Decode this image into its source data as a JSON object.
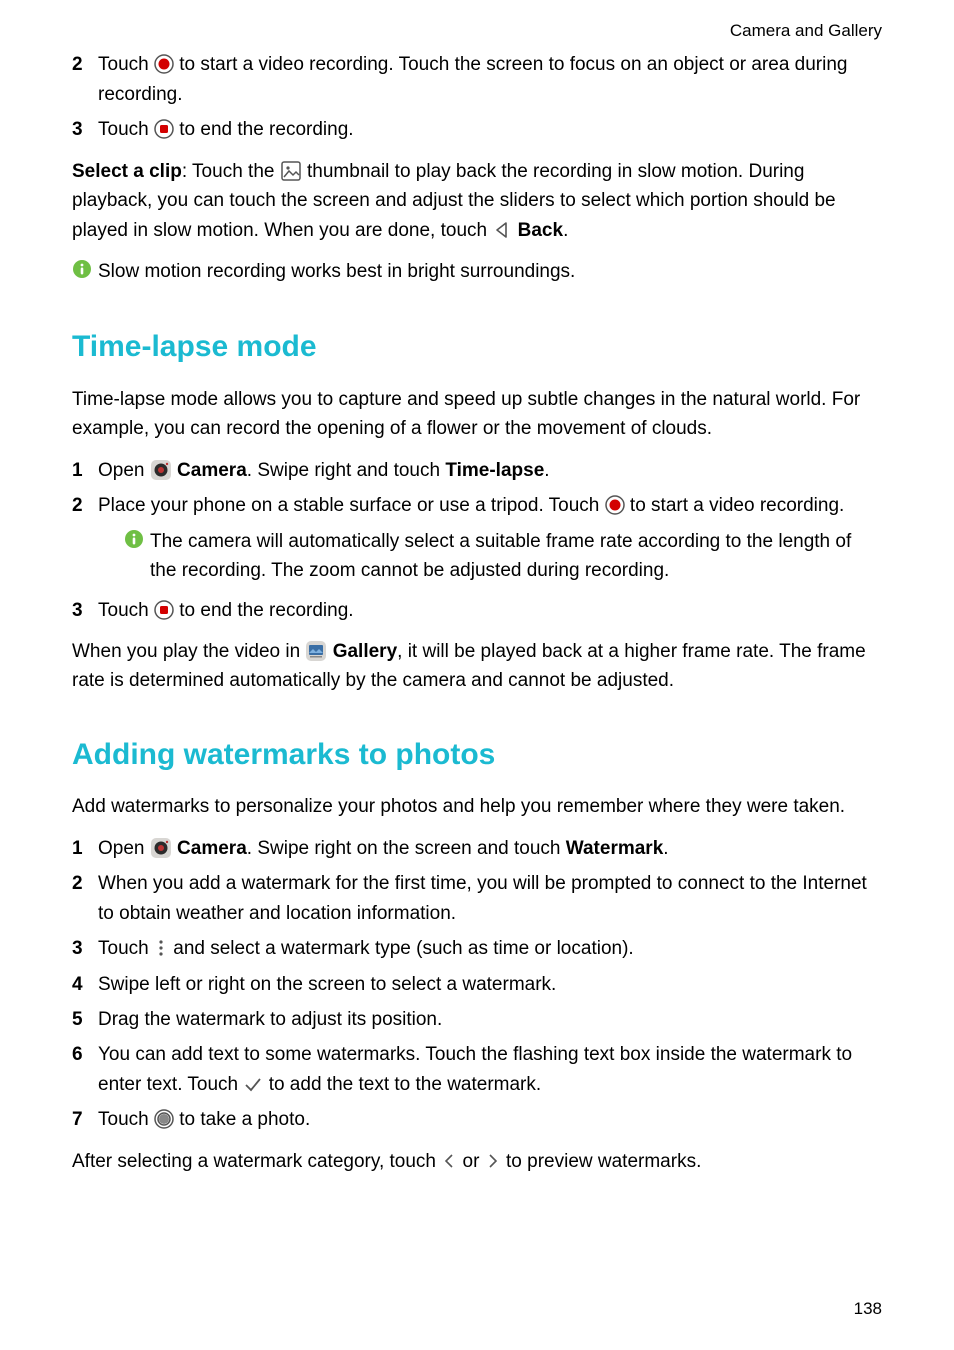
{
  "header": {
    "breadcrumb": "Camera and Gallery"
  },
  "page_number": "138",
  "slowmo": {
    "step2_a": "Touch ",
    "step2_b": " to start a video recording. Touch the screen to focus on an object or area during recording.",
    "step3_a": "Touch ",
    "step3_b": " to end the recording.",
    "select_label": "Select a clip",
    "select_a": ": Touch the ",
    "select_b": " thumbnail to play back the recording in slow motion. During playback, you can touch the screen and adjust the sliders to select which portion should be played in slow motion. When you are done, touch ",
    "back_label": "Back",
    "select_c": ".",
    "note": "Slow motion recording works best in bright surroundings."
  },
  "timelapse": {
    "heading": "Time-lapse mode",
    "intro": "Time-lapse mode allows you to capture and speed up subtle changes in the natural world. For example, you can record the opening of a flower or the movement of clouds.",
    "step1_a": "Open ",
    "camera_label": "Camera",
    "step1_b": ". Swipe right and touch ",
    "timelapse_label": "Time-lapse",
    "step1_c": ".",
    "step2_a": "Place your phone on a stable surface or use a tripod. Touch ",
    "step2_b": " to start a video recording.",
    "step2_note": "The camera will automatically select a suitable frame rate according to the length of the recording. The zoom cannot be adjusted during recording.",
    "step3_a": "Touch ",
    "step3_b": " to end the recording.",
    "outro_a": "When you play the video in ",
    "gallery_label": "Gallery",
    "outro_b": ", it will be played back at a higher frame rate. The frame rate is determined automatically by the camera and cannot be adjusted."
  },
  "watermark": {
    "heading": "Adding watermarks to photos",
    "intro": "Add watermarks to personalize your photos and help you remember where they were taken.",
    "step1_a": "Open ",
    "camera_label": "Camera",
    "step1_b": ". Swipe right on the screen and touch ",
    "watermark_label": "Watermark",
    "step1_c": ".",
    "step2": "When you add a watermark for the first time, you will be prompted to connect to the Internet to obtain weather and location information.",
    "step3_a": "Touch ",
    "step3_b": " and select a watermark type (such as time or location).",
    "step4": "Swipe left or right on the screen to select a watermark.",
    "step5": "Drag the watermark to adjust its position.",
    "step6_a": "You can add text to some watermarks. Touch the flashing text box inside the watermark to enter text. Touch ",
    "step6_b": " to add the text to the watermark.",
    "step7_a": "Touch ",
    "step7_b": " to take a photo.",
    "outro_a": "After selecting a watermark category, touch ",
    "outro_mid": " or ",
    "outro_b": " to preview watermarks."
  },
  "nums": {
    "n1": "1",
    "n2": "2",
    "n3": "3",
    "n4": "4",
    "n5": "5",
    "n6": "6",
    "n7": "7"
  }
}
